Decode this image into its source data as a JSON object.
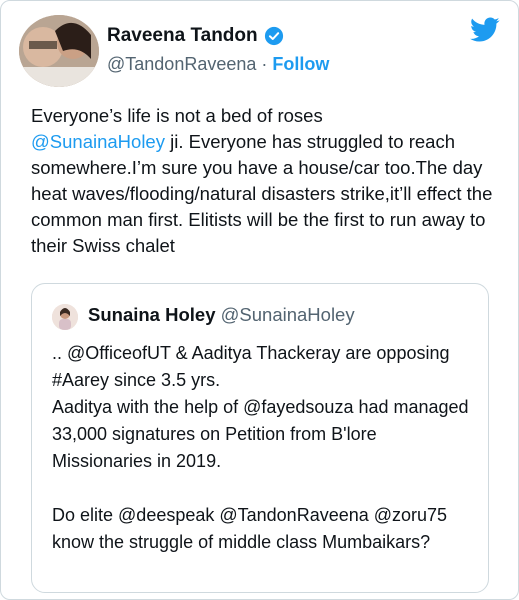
{
  "tweet": {
    "author_name": "Raveena Tandon",
    "author_handle": "@TandonRaveena",
    "separator": "·",
    "follow_label": "Follow",
    "text_part1": "Everyone’s life is not a bed of roses\n",
    "mention": "@SunainaHoley",
    "text_part2": " ji. Everyone has struggled to reach somewhere.I’m sure you have a house/car too.The day heat waves/flooding/natural disasters strike,it’ll effect the common man first. Elitists will be the first to run away to their Swiss chalet"
  },
  "quoted_tweet": {
    "author_name": "Sunaina Holey",
    "author_handle": "@SunainaHoley",
    "text": ".. @OfficeofUT & Aaditya Thackeray are opposing #Aarey since 3.5 yrs.\nAaditya with the help of @fayedsouza had managed 33,000 signatures on Petition from B'lore Missionaries in 2019.\n\nDo elite @deespeak @TandonRaveena @zoru75 know the struggle of middle class Mumbaikars?"
  },
  "colors": {
    "accent": "#1d9bf0",
    "secondary_text": "#536471",
    "border": "#cfd9de"
  }
}
